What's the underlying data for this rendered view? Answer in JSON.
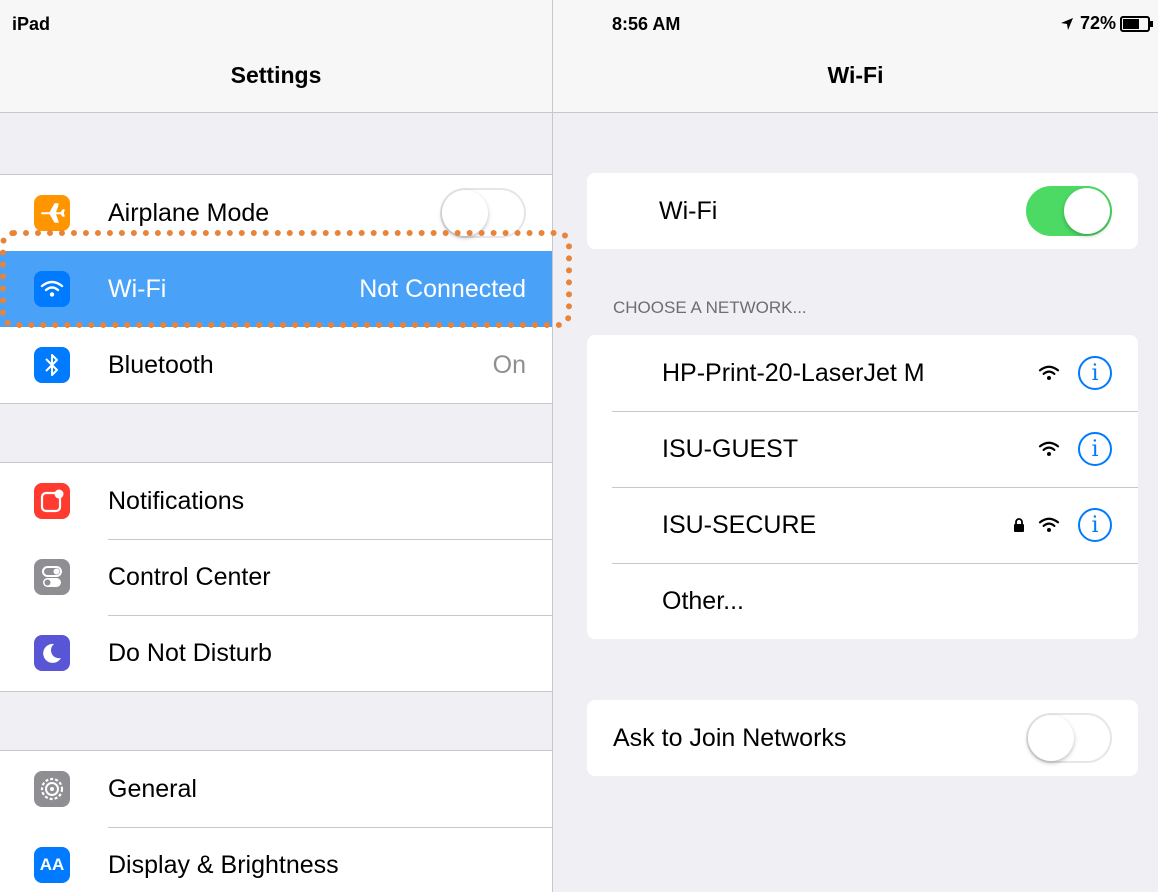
{
  "status": {
    "carrier": "iPad",
    "time": "8:56 AM",
    "battery": "72%",
    "battery_level": 0.72
  },
  "master": {
    "title": "Settings",
    "group1": [
      {
        "label": "Airplane Mode",
        "icon": "airplane-icon",
        "color": "#ff9500",
        "toggle": "off"
      },
      {
        "label": "Wi-Fi",
        "icon": "wifi-icon",
        "color": "#007aff",
        "value": "Not Connected",
        "selected": true
      },
      {
        "label": "Bluetooth",
        "icon": "bluetooth-icon",
        "color": "#007aff",
        "value": "On"
      }
    ],
    "group2": [
      {
        "label": "Notifications",
        "icon": "notifications-icon",
        "color": "#ff3b30"
      },
      {
        "label": "Control Center",
        "icon": "control-center-icon",
        "color": "#8e8e93"
      },
      {
        "label": "Do Not Disturb",
        "icon": "moon-icon",
        "color": "#5856d6"
      }
    ],
    "group3": [
      {
        "label": "General",
        "icon": "gear-icon",
        "color": "#8e8e93"
      },
      {
        "label": "Display & Brightness",
        "icon": "text-size-icon",
        "color": "#007aff",
        "glyph": "AA"
      }
    ]
  },
  "detail": {
    "title": "Wi-Fi",
    "wifi_label": "Wi-Fi",
    "wifi_toggle": "on",
    "section_header": "CHOOSE A NETWORK...",
    "networks": [
      {
        "name": "HP-Print-20-LaserJet M",
        "locked": false
      },
      {
        "name": "ISU-GUEST",
        "locked": false
      },
      {
        "name": "ISU-SECURE",
        "locked": true
      },
      {
        "name": "Other..."
      }
    ],
    "ask_label": "Ask to Join Networks",
    "ask_toggle": "off"
  },
  "colors": {
    "accent": "#007aff",
    "toggle_on": "#4cd964",
    "selected_row": "#4aa2f8",
    "highlight": "#e8833a"
  }
}
